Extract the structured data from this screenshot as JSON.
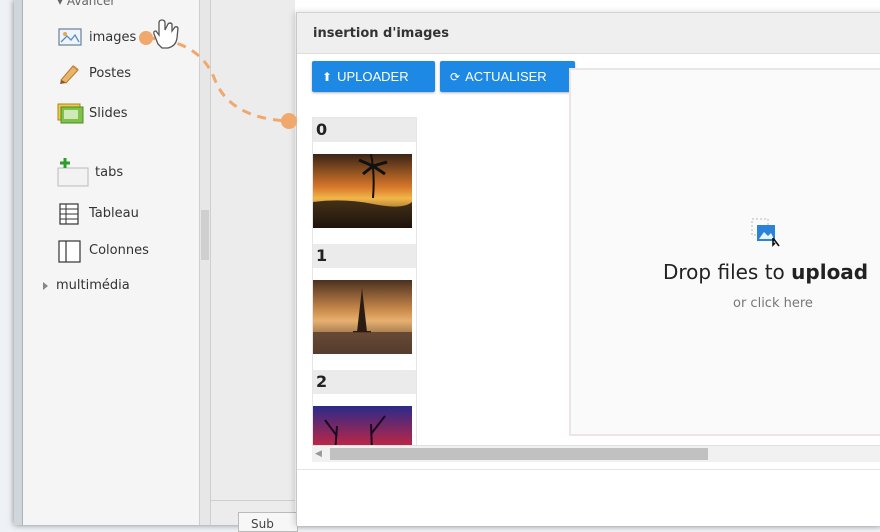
{
  "sidebar": {
    "cut_top_label": "Avancer",
    "items": [
      {
        "label": "images",
        "icon": "image-icon"
      },
      {
        "label": "Postes",
        "icon": "pencil-icon"
      },
      {
        "label": "Slides",
        "icon": "slides-icon"
      },
      {
        "label": "tabs",
        "icon": "add-tab-icon"
      },
      {
        "label": "Tableau",
        "icon": "table-icon"
      },
      {
        "label": "Colonnes",
        "icon": "columns-icon"
      }
    ],
    "group": {
      "label": "multimédia"
    }
  },
  "bottom_tab_label": "Sub",
  "modal": {
    "title": "insertion d'images",
    "buttons": {
      "upload": "UPLOADER",
      "refresh": "ACTUALISER"
    },
    "thumbnails": [
      {
        "label": "0"
      },
      {
        "label": "1"
      },
      {
        "label": "2"
      }
    ],
    "dropzone": {
      "title_prefix": "Drop files to ",
      "title_bold": "upload",
      "subtitle": "or click here"
    }
  },
  "colors": {
    "accent": "#1e88e5",
    "drag_hint": "#f0a86c"
  }
}
